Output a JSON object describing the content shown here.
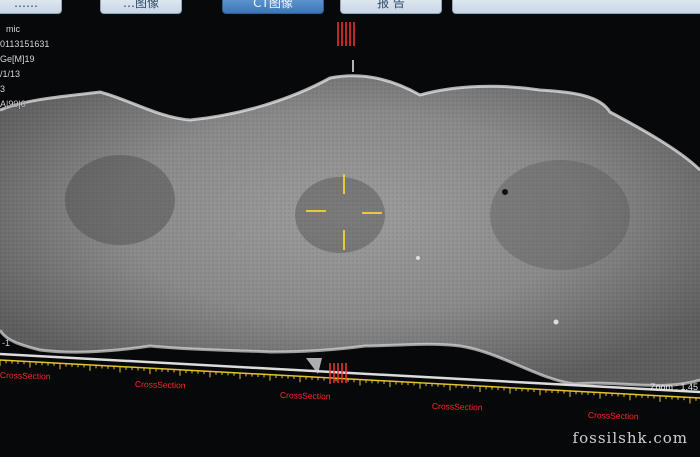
{
  "tabs": [
    {
      "label": "……"
    },
    {
      "label": "…图像"
    },
    {
      "label": "CT图像"
    },
    {
      "label": "报 告"
    }
  ],
  "colors": {
    "crosshair": "#e7c93a",
    "section_label": "#ff2a2a",
    "ruler": "#e3c42d",
    "position_marker": "#ff3333"
  },
  "info_lines": [
    "mic",
    "0113151631",
    "Ge[M]19",
    "/1/13",
    "3",
    "A|90|0"
  ],
  "section_label": "CrossSection",
  "zoom_text": "Zoom : 1.45",
  "left_tick": "-1",
  "watermark": "fossilshk.com"
}
